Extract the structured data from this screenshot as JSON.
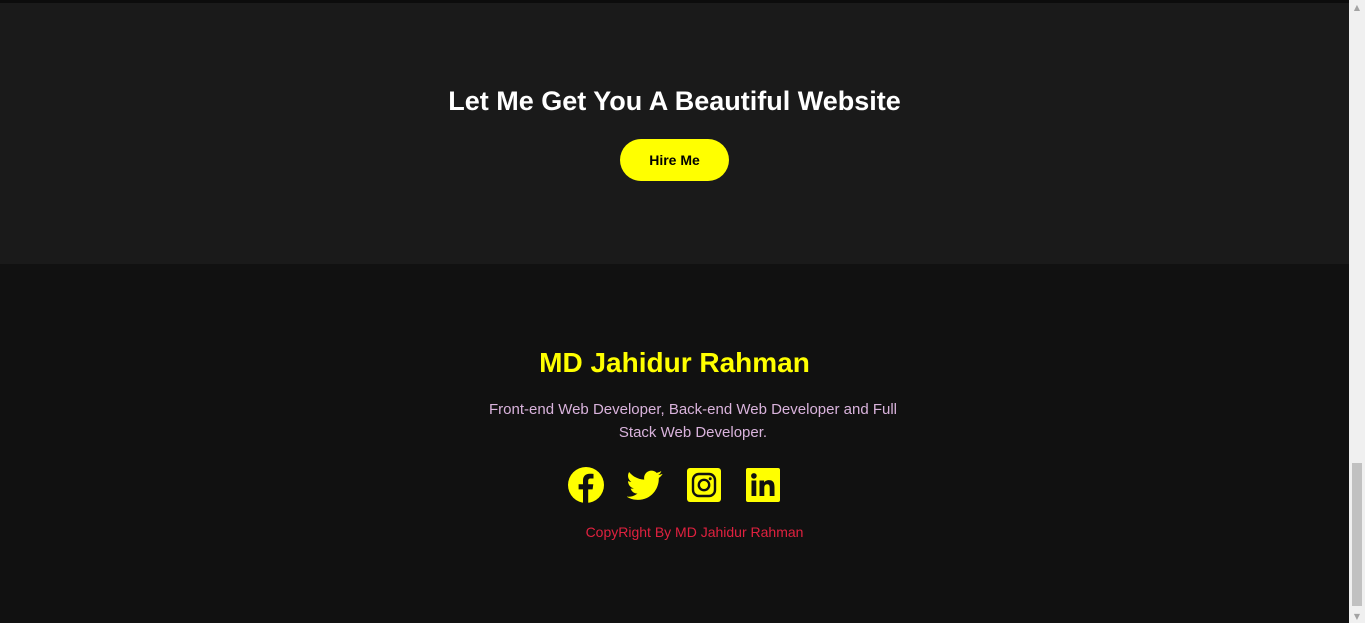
{
  "cta": {
    "heading": "Let Me Get You A Beautiful Website",
    "button_label": "Hire Me"
  },
  "footer": {
    "name": "MD Jahidur Rahman",
    "description": "Front-end Web Developer, Back-end Web Developer and Full Stack Web Developer.",
    "copyright": "CopyRight By MD Jahidur Rahman",
    "socials": [
      {
        "icon": "facebook-icon"
      },
      {
        "icon": "twitter-icon"
      },
      {
        "icon": "instagram-icon"
      },
      {
        "icon": "linkedin-icon"
      }
    ]
  },
  "colors": {
    "accent": "#ffff00",
    "cta_background": "#1a1a1a",
    "footer_background": "#111111",
    "description_text": "#d9b3dc",
    "copyright_text": "#e0213f"
  },
  "scrollbar": {
    "up_arrow": "▲",
    "down_arrow": "▼"
  }
}
